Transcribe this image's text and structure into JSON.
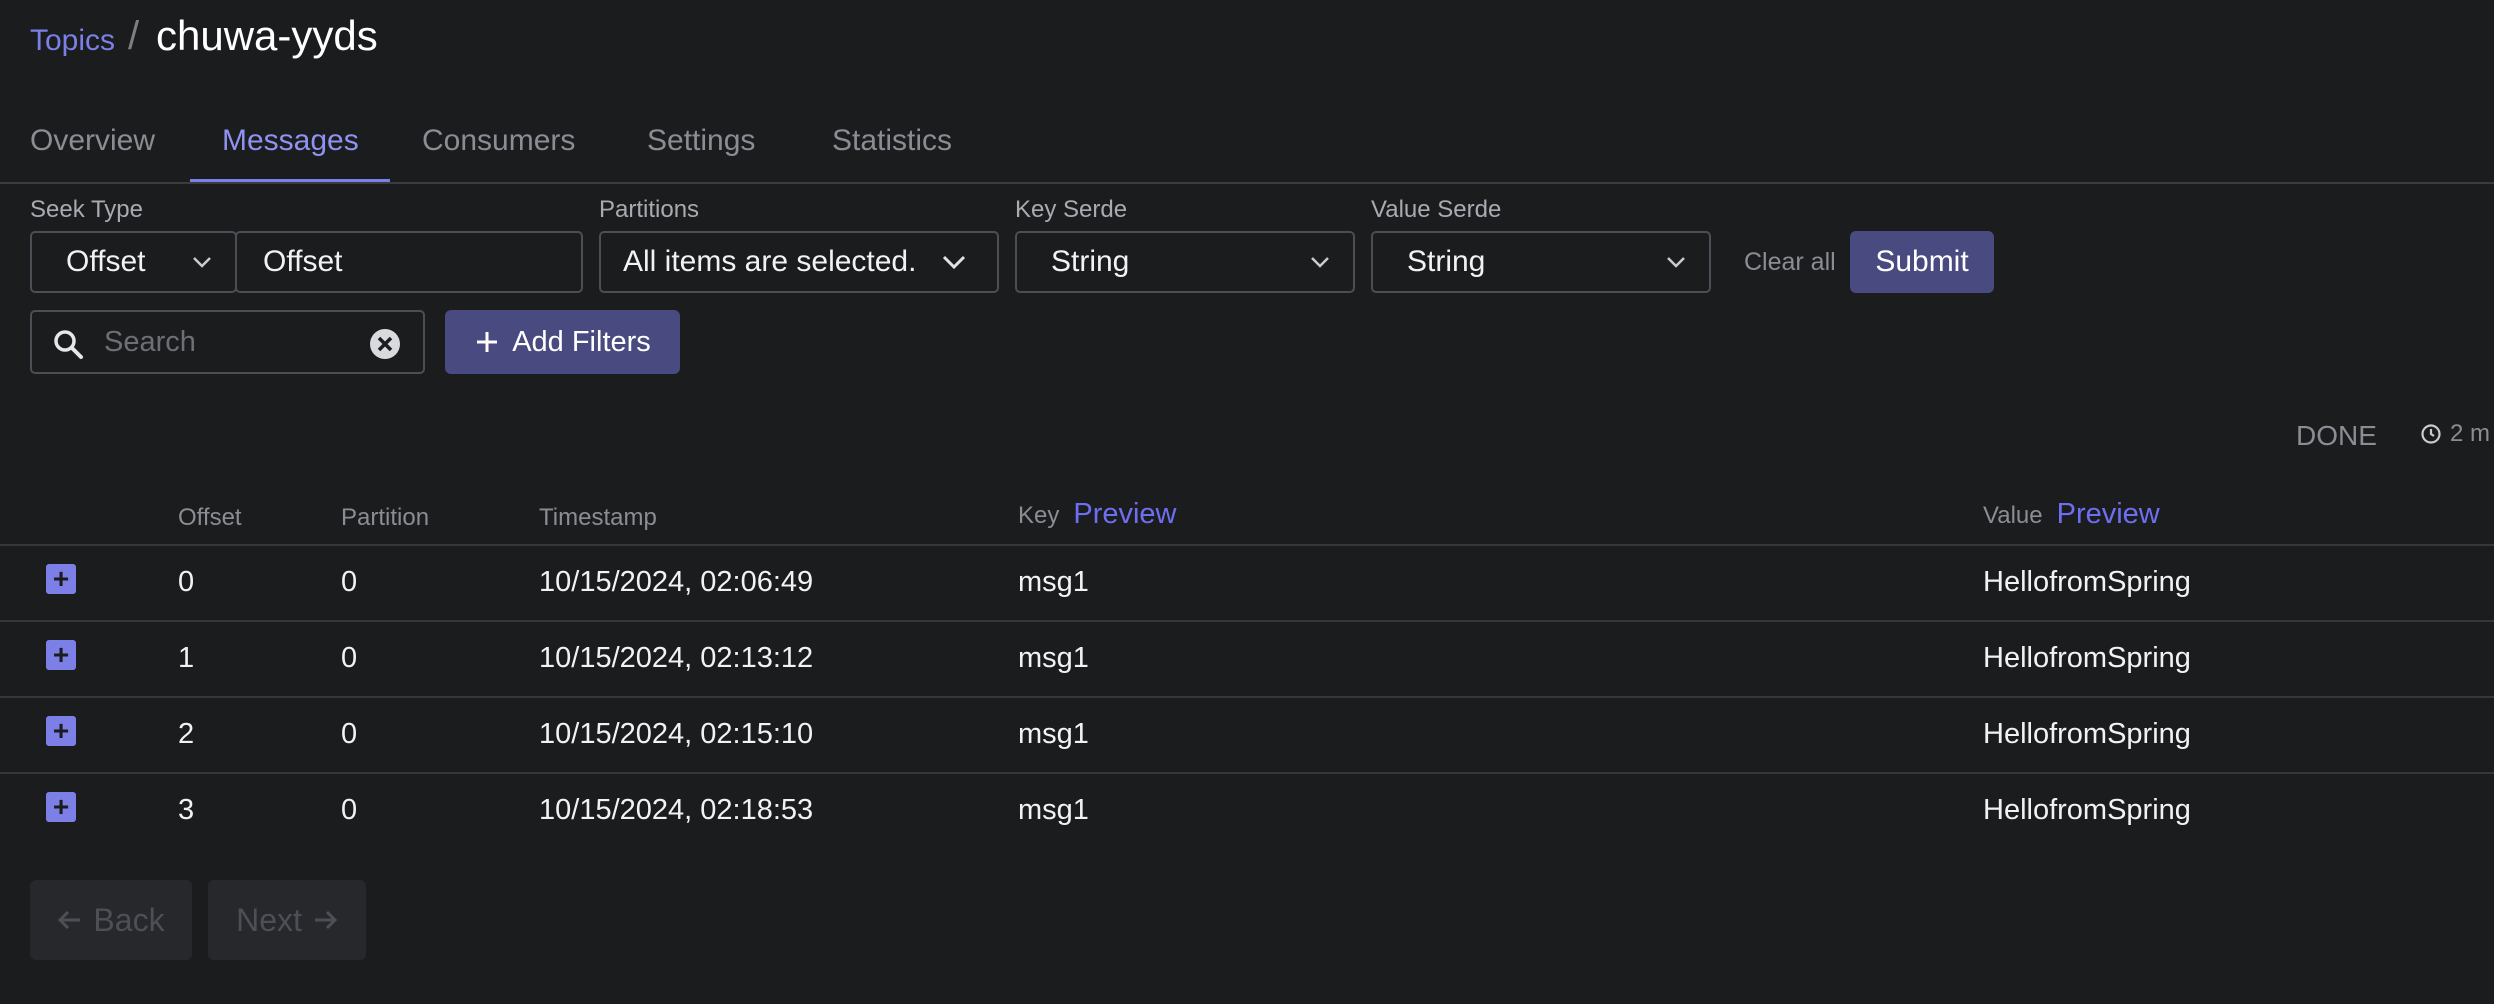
{
  "breadcrumb": {
    "parent": "Topics",
    "separator": "/",
    "title": "chuwa-yyds"
  },
  "tabs": [
    {
      "label": "Overview"
    },
    {
      "label": "Messages",
      "active": true
    },
    {
      "label": "Consumers"
    },
    {
      "label": "Settings"
    },
    {
      "label": "Statistics"
    }
  ],
  "filters": {
    "seek_type_label": "Seek Type",
    "seek_type_value": "Offset",
    "seek_offset_value": "Offset",
    "partitions_label": "Partitions",
    "partitions_value": "All items are selected.",
    "key_serde_label": "Key Serde",
    "key_serde_value": "String",
    "value_serde_label": "Value Serde",
    "value_serde_value": "String",
    "clear_all": "Clear all",
    "submit": "Submit",
    "search_placeholder": "Search",
    "add_filters": "Add Filters"
  },
  "status": {
    "state": "DONE",
    "elapsed": "2 m"
  },
  "table": {
    "headers": {
      "offset": "Offset",
      "partition": "Partition",
      "timestamp": "Timestamp",
      "key": "Key",
      "value": "Value",
      "preview": "Preview"
    },
    "rows": [
      {
        "offset": "0",
        "partition": "0",
        "timestamp": "10/15/2024, 02:06:49",
        "key": "msg1",
        "value": "HellofromSpring"
      },
      {
        "offset": "1",
        "partition": "0",
        "timestamp": "10/15/2024, 02:13:12",
        "key": "msg1",
        "value": "HellofromSpring"
      },
      {
        "offset": "2",
        "partition": "0",
        "timestamp": "10/15/2024, 02:15:10",
        "key": "msg1",
        "value": "HellofromSpring"
      },
      {
        "offset": "3",
        "partition": "0",
        "timestamp": "10/15/2024, 02:18:53",
        "key": "msg1",
        "value": "HellofromSpring"
      }
    ]
  },
  "pagination": {
    "back": "Back",
    "next": "Next"
  },
  "colors": {
    "accent": "#7b7fe6",
    "button_bg": "#484a80",
    "background": "#1b1c1e"
  },
  "icons": [
    "chevron-down-icon",
    "search-icon",
    "clear-icon",
    "plus-icon",
    "clock-icon",
    "expand-icon",
    "arrow-left-icon",
    "arrow-right-icon"
  ]
}
